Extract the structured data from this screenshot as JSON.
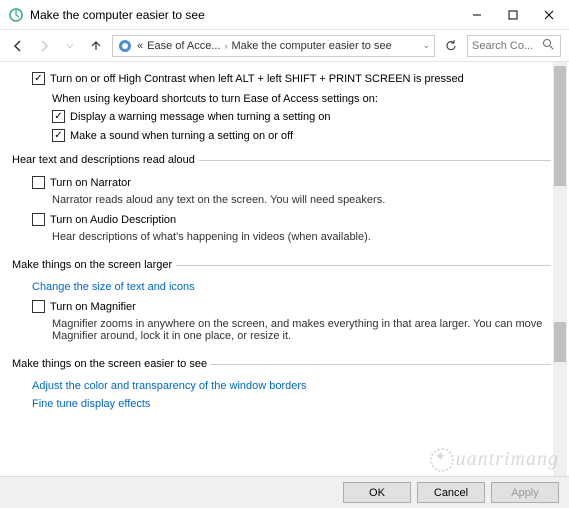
{
  "window": {
    "title": "Make the computer easier to see"
  },
  "breadcrumb": {
    "prefix": "«",
    "part1": "Ease of Acce...",
    "part2": "Make the computer easier to see"
  },
  "search": {
    "placeholder": "Search Co..."
  },
  "highContrast": {
    "label": "Turn on or off High Contrast when left ALT + left SHIFT + PRINT SCREEN is pressed",
    "subheading": "When using keyboard shortcuts to turn Ease of Access settings on:",
    "warn": "Display a warning message when turning a setting on",
    "sound": "Make a sound when turning a setting on or off"
  },
  "sections": {
    "hear": {
      "legend": "Hear text and descriptions read aloud",
      "narrator": "Turn on Narrator",
      "narratorDesc": "Narrator reads aloud any text on the screen. You will need speakers.",
      "audio": "Turn on Audio Description",
      "audioDesc": "Hear descriptions of what's happening in videos (when available)."
    },
    "larger": {
      "legend": "Make things on the screen larger",
      "link": "Change the size of text and icons",
      "magnifier": "Turn on Magnifier",
      "magnifierDesc": "Magnifier zooms in anywhere on the screen, and makes everything in that area larger. You can move Magnifier around, lock it in one place, or resize it."
    },
    "easier": {
      "legend": "Make things on the screen easier to see",
      "link1": "Adjust the color and transparency of the window borders",
      "link2": "Fine tune display effects"
    }
  },
  "buttons": {
    "ok": "OK",
    "cancel": "Cancel",
    "apply": "Apply"
  },
  "watermark": "uantrimang"
}
